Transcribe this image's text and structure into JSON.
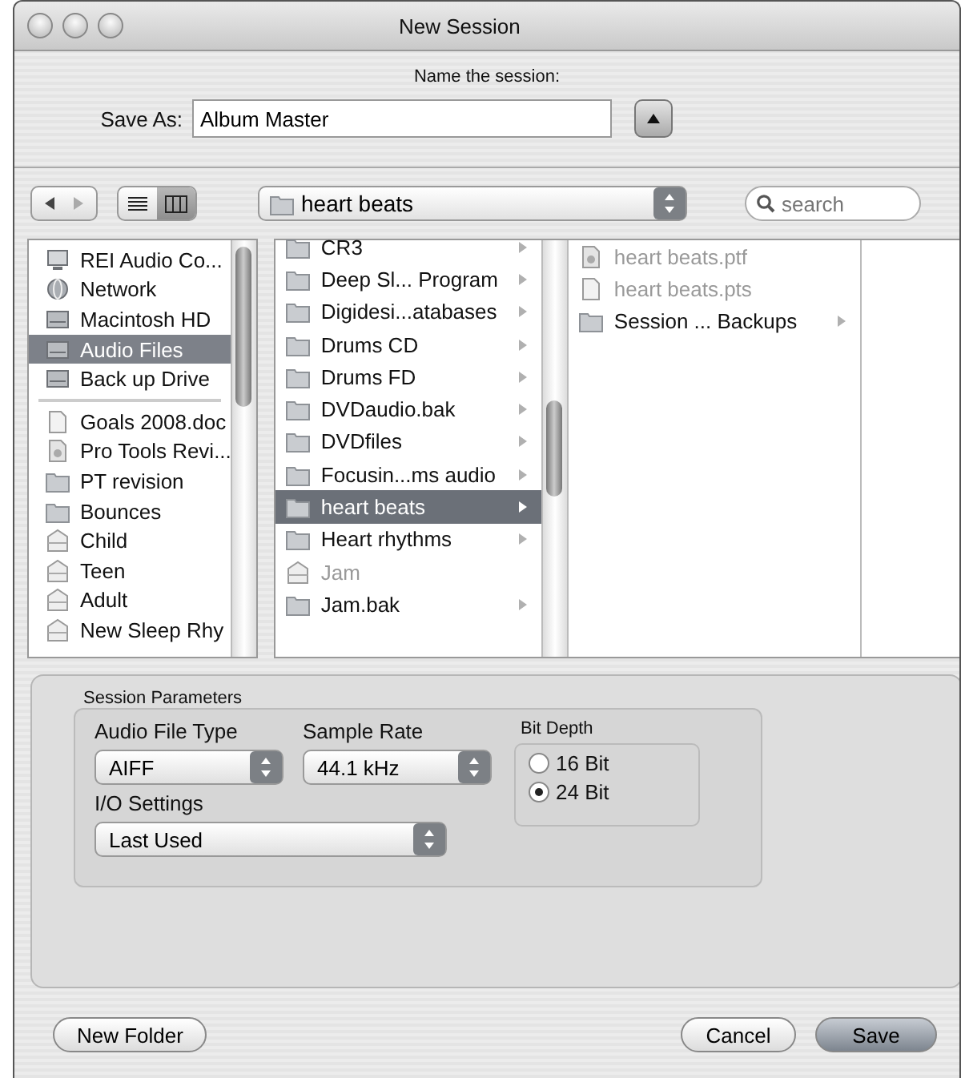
{
  "window": {
    "title": "New Session"
  },
  "prompt": "Name the session:",
  "save_as": {
    "label": "Save As:",
    "value": "Album Master"
  },
  "toolbar": {
    "view_modes": [
      {
        "kind": "list",
        "selected": false
      },
      {
        "kind": "columns",
        "selected": true
      }
    ],
    "location": "heart beats",
    "search": {
      "placeholder": "search"
    }
  },
  "sidebar": {
    "devices": [
      {
        "label": "REI Audio Co...",
        "kind": "computer",
        "selected": false
      },
      {
        "label": "Network",
        "kind": "network",
        "selected": false
      },
      {
        "label": "Macintosh HD",
        "kind": "drive",
        "selected": false
      },
      {
        "label": "Audio Files",
        "kind": "drive",
        "selected": true
      },
      {
        "label": "Back up Drive",
        "kind": "drive",
        "selected": false
      }
    ],
    "places": [
      {
        "label": "Goals 2008.doc",
        "kind": "document",
        "selected": false
      },
      {
        "label": "Pro Tools Revi...",
        "kind": "session",
        "selected": false
      },
      {
        "label": "PT revision",
        "kind": "folder",
        "selected": false
      },
      {
        "label": "Bounces",
        "kind": "folder",
        "selected": false
      },
      {
        "label": "Child",
        "kind": "table",
        "selected": false
      },
      {
        "label": "Teen",
        "kind": "table",
        "selected": false
      },
      {
        "label": "Adult",
        "kind": "table",
        "selected": false
      },
      {
        "label": "New Sleep Rhy",
        "kind": "table",
        "selected": false
      }
    ]
  },
  "columns": [
    {
      "items": [
        {
          "label": "CR3",
          "kind": "folder",
          "has_children": true,
          "dimmed": false,
          "selected": false
        },
        {
          "label": "Deep Sl... Program",
          "kind": "folder",
          "has_children": true,
          "dimmed": false,
          "selected": false
        },
        {
          "label": "Digidesi...atabases",
          "kind": "folder",
          "has_children": true,
          "dimmed": false,
          "selected": false
        },
        {
          "label": "Drums CD",
          "kind": "folder",
          "has_children": true,
          "dimmed": false,
          "selected": false
        },
        {
          "label": "Drums FD",
          "kind": "folder",
          "has_children": true,
          "dimmed": false,
          "selected": false
        },
        {
          "label": "DVDaudio.bak",
          "kind": "folder",
          "has_children": true,
          "dimmed": false,
          "selected": false
        },
        {
          "label": "DVDfiles",
          "kind": "folder",
          "has_children": true,
          "dimmed": false,
          "selected": false
        },
        {
          "label": "Focusin...ms audio",
          "kind": "folder",
          "has_children": true,
          "dimmed": false,
          "selected": false
        },
        {
          "label": "heart beats",
          "kind": "folder",
          "has_children": true,
          "dimmed": false,
          "selected": true
        },
        {
          "label": "Heart rhythms",
          "kind": "folder",
          "has_children": true,
          "dimmed": false,
          "selected": false
        },
        {
          "label": "Jam",
          "kind": "table",
          "has_children": false,
          "dimmed": true,
          "selected": false
        },
        {
          "label": "Jam.bak",
          "kind": "folder",
          "has_children": true,
          "dimmed": false,
          "selected": false
        }
      ]
    },
    {
      "items": [
        {
          "label": "heart beats.ptf",
          "kind": "session",
          "has_children": false,
          "dimmed": true,
          "selected": false
        },
        {
          "label": "heart beats.pts",
          "kind": "document",
          "has_children": false,
          "dimmed": true,
          "selected": false
        },
        {
          "label": "Session ... Backups",
          "kind": "folder",
          "has_children": true,
          "dimmed": false,
          "selected": false
        }
      ]
    }
  ],
  "session_parameters": {
    "title": "Session Parameters",
    "audio_file_type": {
      "label": "Audio File Type",
      "value": "AIFF"
    },
    "sample_rate": {
      "label": "Sample Rate",
      "value": "44.1 kHz"
    },
    "io_settings": {
      "label": "I/O Settings",
      "value": "Last Used"
    },
    "bit_depth": {
      "label": "Bit Depth",
      "options": [
        {
          "label": "16 Bit",
          "selected": false
        },
        {
          "label": "24 Bit",
          "selected": true
        }
      ]
    }
  },
  "footer": {
    "left": [
      {
        "label": "New Folder",
        "kind": "plain"
      }
    ],
    "right": [
      {
        "label": "Cancel",
        "kind": "plain"
      },
      {
        "label": "Save",
        "kind": "default"
      }
    ]
  }
}
